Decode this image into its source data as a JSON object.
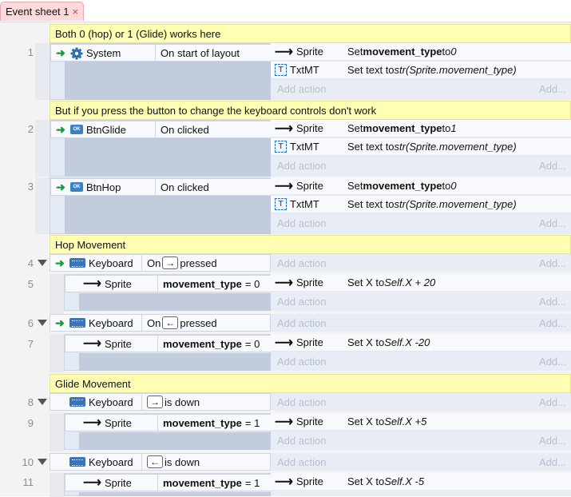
{
  "tab": {
    "title": "Event sheet 1",
    "close": "×"
  },
  "comments": {
    "c1": "Both 0 (hop) or 1 (Glide) works here",
    "c2": "But if you press the button to change the keyboard controls don't work",
    "c3": "Hop Movement",
    "c4": "Glide Movement"
  },
  "labels": {
    "add_action": "Add action",
    "add_dots": "Add...",
    "on": "On",
    "pressed": "pressed",
    "is_down": "is down"
  },
  "events": {
    "e1": {
      "num": "1",
      "obj": "System",
      "cond": "On start of layout"
    },
    "e2": {
      "num": "2",
      "obj": "BtnGlide",
      "cond": "On clicked"
    },
    "e3": {
      "num": "3",
      "obj": "BtnHop",
      "cond": "On clicked"
    },
    "e4": {
      "num": "4",
      "obj": "Keyboard",
      "key": "→"
    },
    "e5": {
      "num": "5",
      "obj": "Sprite",
      "var": "movement_type",
      "op": "= 0"
    },
    "e6": {
      "num": "6",
      "obj": "Keyboard",
      "key": "←"
    },
    "e7": {
      "num": "7",
      "obj": "Sprite",
      "var": "movement_type",
      "op": "= 0"
    },
    "e8": {
      "num": "8",
      "obj": "Keyboard",
      "key": "→"
    },
    "e9": {
      "num": "9",
      "obj": "Sprite",
      "var": "movement_type",
      "op": "= 1"
    },
    "e10": {
      "num": "10",
      "obj": "Keyboard",
      "key": "←"
    },
    "e11": {
      "num": "11",
      "obj": "Sprite",
      "var": "movement_type",
      "op": "= 1"
    }
  },
  "actions": {
    "a1a": {
      "obj": "Sprite",
      "pre": "Set ",
      "bold": "movement_type",
      "mid": " to ",
      "it": "0"
    },
    "a1b": {
      "obj": "TxtMT",
      "pre": "Set text to ",
      "it": "str(Sprite.movement_type)"
    },
    "a2a": {
      "obj": "Sprite",
      "pre": "Set ",
      "bold": "movement_type",
      "mid": " to ",
      "it": "1"
    },
    "a2b": {
      "obj": "TxtMT",
      "pre": "Set text to ",
      "it": "str(Sprite.movement_type)"
    },
    "a3a": {
      "obj": "Sprite",
      "pre": "Set ",
      "bold": "movement_type",
      "mid": " to ",
      "it": "0"
    },
    "a3b": {
      "obj": "TxtMT",
      "pre": "Set text to ",
      "it": "str(Sprite.movement_type)"
    },
    "a5": {
      "obj": "Sprite",
      "pre": "Set X to ",
      "it": "Self.X + 20"
    },
    "a7": {
      "obj": "Sprite",
      "pre": "Set X to ",
      "it": "Self.X -20"
    },
    "a9": {
      "obj": "Sprite",
      "pre": "Set X to ",
      "it": "Self.X +5"
    },
    "a11": {
      "obj": "Sprite",
      "pre": "Set X to ",
      "it": "Self.X -5"
    }
  }
}
